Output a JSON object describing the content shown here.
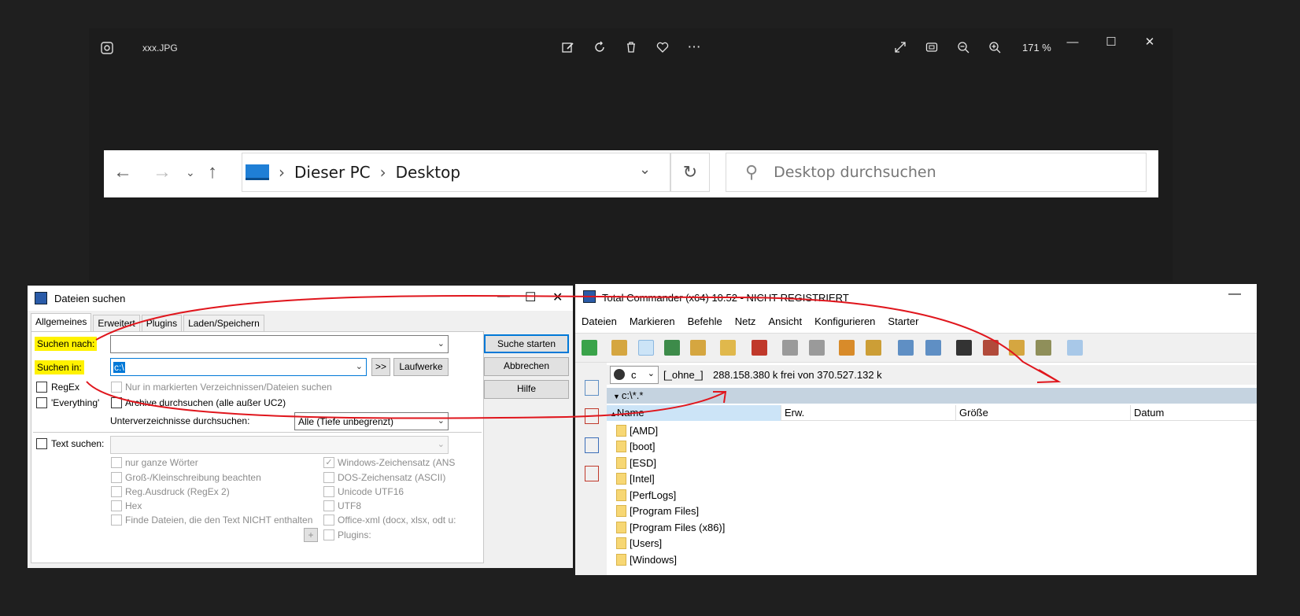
{
  "viewer": {
    "filename": "xxx.JPG",
    "zoom": "171 %",
    "icons": {
      "app": "photo-app-icon",
      "edit": "edit-image-icon",
      "rotate": "rotate-icon",
      "delete": "trash-icon",
      "favorite": "heart-icon",
      "more": "more-icon",
      "fullscreen": "fullscreen-icon",
      "fit": "fit-window-icon",
      "zoom_out": "zoom-out-icon",
      "zoom_in": "zoom-in-icon",
      "minimize": "minimize-icon",
      "maximize": "maximize-icon",
      "close": "close-icon"
    }
  },
  "explorer": {
    "crumb_1": "Dieser PC",
    "crumb_2": "Desktop",
    "search_placeholder": "Desktop durchsuchen"
  },
  "find_dialog": {
    "title": "Dateien suchen",
    "tabs": [
      "Allgemeines",
      "Erweitert",
      "Plugins",
      "Laden/Speichern"
    ],
    "search_for_label": "Suchen nach:",
    "search_in_label": "Suchen in:",
    "search_in_value": "c:\\",
    "browse_button": ">>",
    "drives_button": "Laufwerke",
    "start_button": "Suche starten",
    "cancel_button": "Abbrechen",
    "help_button": "Hilfe",
    "regex_label": "RegEx",
    "everything_label": "'Everything'",
    "only_marked_label": "Nur in markierten Verzeichnissen/Dateien suchen",
    "archives_label": "Archive durchsuchen (alle außer UC2)",
    "subdirs_label": "Unterverzeichnisse durchsuchen:",
    "subdirs_value": "Alle (Tiefe unbegrenzt)",
    "text_search_label": "Text suchen:",
    "left_options": [
      "nur ganze Wörter",
      "Groß-/Kleinschreibung beachten",
      "Reg.Ausdruck (RegEx 2)",
      "Hex",
      "Finde Dateien, die den Text NICHT enthalten"
    ],
    "right_options": [
      "Windows-Zeichensatz (ANS",
      "DOS-Zeichensatz (ASCII)",
      "Unicode UTF16",
      "UTF8",
      "Office-xml (docx, xlsx, odt u:",
      "Plugins:"
    ],
    "plus_button": "+"
  },
  "tc": {
    "title": "Total Commander (x64) 10.52 - NICHT REGISTRIERT",
    "menu": [
      "Dateien",
      "Markieren",
      "Befehle",
      "Netz",
      "Ansicht",
      "Konfigurieren",
      "Starter"
    ],
    "drive": "c",
    "volume": "[_ohne_]",
    "free_space": "288.158.380 k frei von 370.527.132 k",
    "path": "c:\\*.*",
    "columns": [
      "Name",
      "Erw.",
      "Größe",
      "Datum"
    ],
    "folders": [
      "[AMD]",
      "[boot]",
      "[ESD]",
      "[Intel]",
      "[PerfLogs]",
      "[Program Files]",
      "[Program Files (x86)]",
      "[Users]",
      "[Windows]"
    ]
  },
  "colors": {
    "annotation_arrow": "#e0161d",
    "highlight": "#fff200"
  }
}
